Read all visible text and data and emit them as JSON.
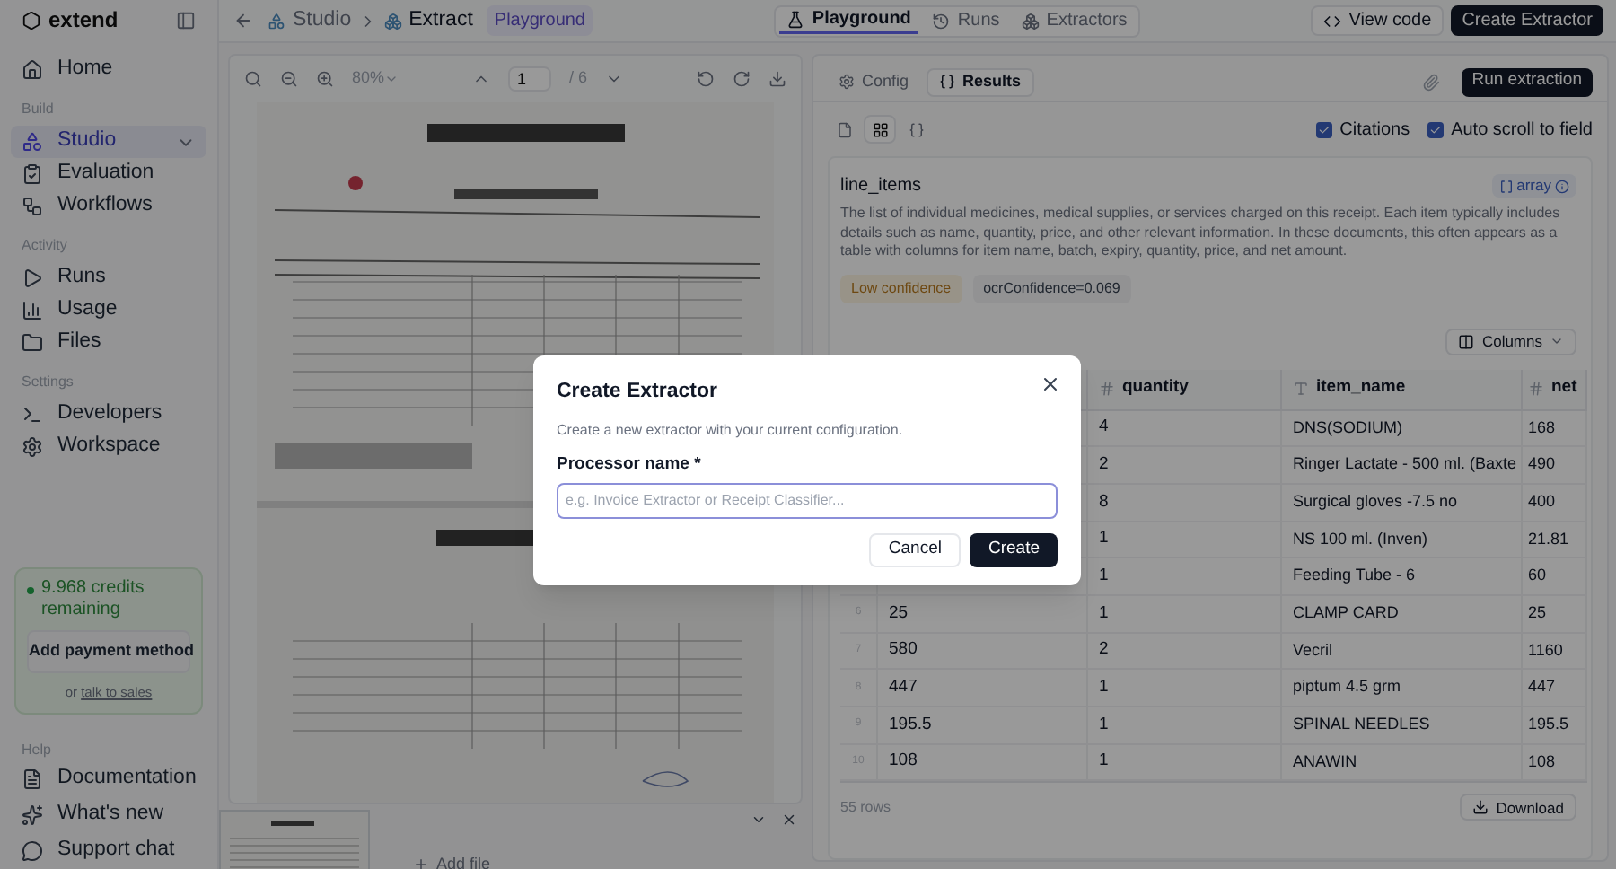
{
  "sidebar": {
    "brand": "extend",
    "sections": [
      {
        "items": [
          {
            "label": "Home",
            "selected": false
          }
        ]
      },
      {
        "title": "Build",
        "items": [
          {
            "label": "Studio",
            "selected": true,
            "expandable": true
          },
          {
            "label": "Evaluation",
            "selected": false
          },
          {
            "label": "Workflows",
            "selected": false
          }
        ]
      },
      {
        "title": "Activity",
        "items": [
          {
            "label": "Runs",
            "selected": false
          },
          {
            "label": "Usage",
            "selected": false
          },
          {
            "label": "Files",
            "selected": false
          }
        ]
      },
      {
        "title": "Settings",
        "items": [
          {
            "label": "Developers",
            "selected": false
          },
          {
            "label": "Workspace",
            "selected": false
          }
        ]
      }
    ],
    "credits": {
      "text": "9.968 credits remaining",
      "button": "Add payment method",
      "prefix": "or",
      "link": "talk to sales"
    },
    "help": {
      "title": "Help",
      "items": [
        {
          "label": "Documentation",
          "selected": false
        },
        {
          "label": "What's new",
          "selected": false
        },
        {
          "label": "Support chat",
          "selected": false
        }
      ]
    }
  },
  "topbar": {
    "breadcrumb": [
      "Studio",
      "Extract"
    ],
    "badge": "Playground",
    "tabs": [
      {
        "label": "Playground",
        "selected": true
      },
      {
        "label": "Runs",
        "selected": false
      },
      {
        "label": "Extractors",
        "selected": false
      }
    ],
    "buttons": [
      {
        "label": "View code",
        "kind": "secondary"
      },
      {
        "label": "Create Extractor",
        "kind": "primary"
      }
    ]
  },
  "viewer": {
    "zoom": "80%",
    "page": "1",
    "page_count": "/ 6",
    "add_file": "Add file"
  },
  "results": {
    "tabs": [
      {
        "label": "Config",
        "selected": false
      },
      {
        "label": "Results",
        "selected": true
      }
    ],
    "run_button": "Run extraction",
    "view_modes": [
      {
        "selected": false
      },
      {
        "selected": true
      },
      {
        "selected": false
      }
    ],
    "options": [
      {
        "label": "Citations",
        "checked": true
      },
      {
        "label": "Auto scroll to field",
        "checked": true
      }
    ],
    "field": {
      "name": "line_items",
      "type": "array",
      "description": "The list of individual medicines, medical supplies, or services charged on this receipt. Each item typically includes details such as name, quantity, price, and other relevant information. In these documents, this often appears as a table with columns for item name, batch, expiry, quantity, price, and net amount.",
      "confidence": "Low confidence",
      "ocr": "ocrConfidence=0.069"
    },
    "columns_button": "Columns",
    "table": {
      "columns": [
        {
          "name": "quantity",
          "kind": "number"
        },
        {
          "name": "item_name",
          "kind": "text"
        },
        {
          "name": "net",
          "kind": "number"
        }
      ],
      "rows": [
        {
          "quantity": "4",
          "item_name": "DNS(SODIUM)",
          "net": "168"
        },
        {
          "quantity": "2",
          "item_name": "Ringer Lactate - 500 ml. (Baxte",
          "net": "490"
        },
        {
          "quantity": "8",
          "item_name": "Surgical gloves -7.5 no",
          "net": "400"
        },
        {
          "quantity": "1",
          "item_name": "NS 100 ml. (Inven)",
          "net": "21.81"
        },
        {
          "quantity": "1",
          "item_name": "Feeding Tube - 6",
          "net": "60"
        },
        {
          "number": "6",
          "column_2": "25",
          "quantity": "1",
          "item_name": "CLAMP CARD",
          "net": "25"
        },
        {
          "number": "7",
          "column_2": "580",
          "quantity": "2",
          "item_name": "Vecril",
          "net": "1160"
        },
        {
          "number": "8",
          "column_2": "447",
          "quantity": "1",
          "item_name": "piptum 4.5 grm",
          "net": "447"
        },
        {
          "number": "9",
          "column_2": "195.5",
          "quantity": "1",
          "item_name": "SPINAL NEEDLES",
          "net": "195.5"
        },
        {
          "number": "10",
          "column_2": "108",
          "quantity": "1",
          "item_name": "ANAWIN",
          "net": "108"
        }
      ]
    },
    "row_count": "55 rows",
    "download": "Download"
  },
  "modal": {
    "title": "Create Extractor",
    "description": "Create a new extractor with your current configuration.",
    "label": "Processor name *",
    "placeholder": "e.g. Invoice Extractor or Receipt Classifier...",
    "buttons": [
      {
        "label": "Cancel",
        "kind": "secondary"
      },
      {
        "label": "Create",
        "kind": "primary"
      }
    ]
  }
}
